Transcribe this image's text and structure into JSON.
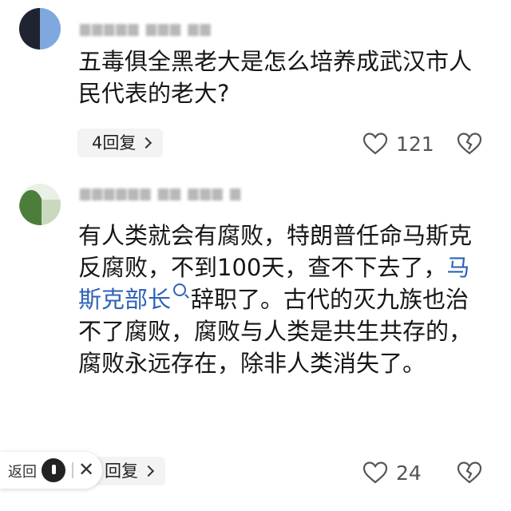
{
  "comments": [
    {
      "text": "五毒俱全黑老大是怎么培养成武汉市人民代表的老大?",
      "reply_label": "4回复",
      "like_count": "121"
    },
    {
      "text_part1": "有人类就会有腐败，特朗普任命马斯克反腐败，不到100天，查不下去了，",
      "link_text": "马斯克部长",
      "text_part2": "辞职了。古代的灭九族也治不了腐败，腐败与人类是共生共存的，腐败永远存在，除非人类消失了。",
      "reply_label": "回复",
      "like_count": "24"
    }
  ],
  "back_overlay": {
    "label": "返回",
    "close": "✕"
  },
  "icons": {
    "like": "heart-outline-icon",
    "dislike": "broken-heart-icon",
    "search": "search-icon"
  },
  "colors": {
    "link": "#2f62b8",
    "reply_bg": "#f3f3f3",
    "meta": "#b8b8b8"
  }
}
